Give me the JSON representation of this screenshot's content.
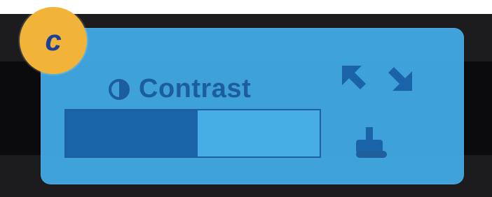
{
  "badge": {
    "letter": "c",
    "color": "#f2b339",
    "text_color": "#1d3f99"
  },
  "panel": {
    "title": "Contrast",
    "title_icon": "half-circle-contrast-icon",
    "background_color": "#42a8e2",
    "accent_color": "#1c5d9e"
  },
  "contrast_level": {
    "value_percent": 52,
    "fill_color": "#1b63a8",
    "track_color": "#47ade6"
  },
  "icons": {
    "left_arrow": "arrow-up-left-icon",
    "right_arrow": "arrow-down-right-icon",
    "hand": "hand-pointer-icon"
  }
}
